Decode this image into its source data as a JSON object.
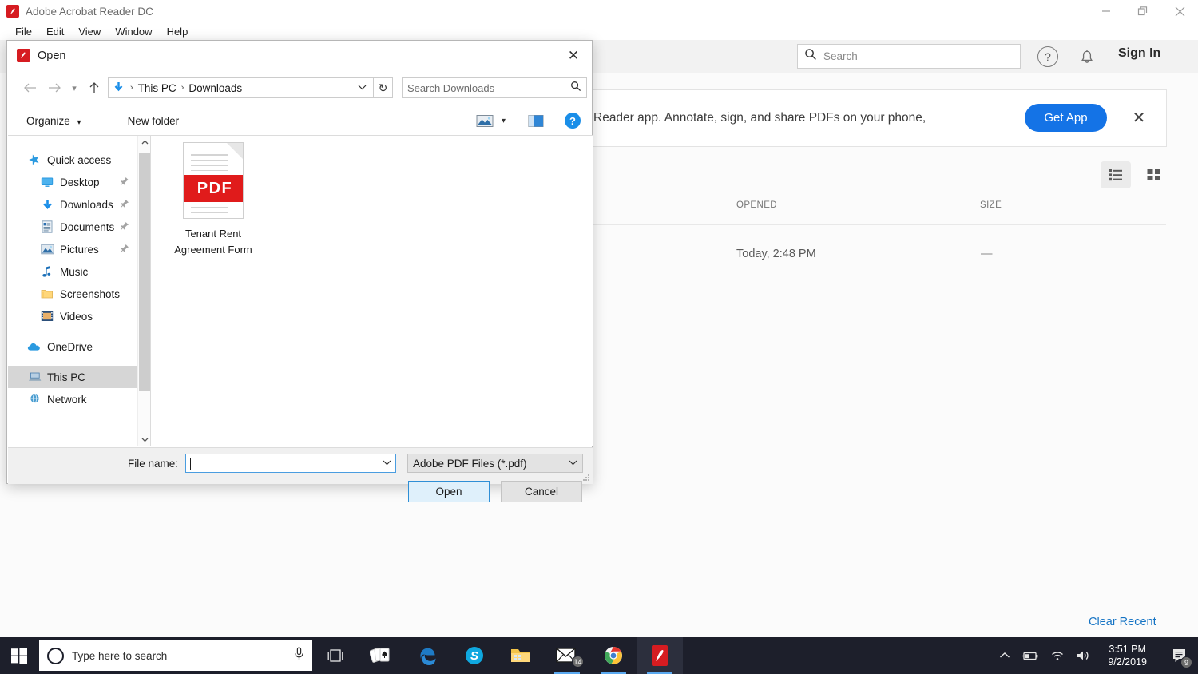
{
  "acrobat": {
    "title": "Adobe Acrobat Reader DC",
    "logo_letter": "A",
    "menu": [
      "File",
      "Edit",
      "View",
      "Window",
      "Help"
    ],
    "window_controls": {
      "minimize": "minimize-icon",
      "restore": "restore-icon",
      "close": "close-icon"
    },
    "search": {
      "placeholder": "Search",
      "icon": "search-icon"
    },
    "help_icon": "?",
    "bell_icon": "notification-bell-icon",
    "sign_in": "Sign In"
  },
  "promo": {
    "text": "Reader app. Annotate, sign, and share PDFs on your phone,",
    "button": "Get App",
    "close": "✕",
    "accent": "#1473e6"
  },
  "recent_list": {
    "view_toggle": {
      "list": "list-view-icon",
      "grid": "grid-view-icon",
      "active": "list"
    },
    "columns": [
      "OPENED",
      "SIZE"
    ],
    "rows": [
      {
        "opened": "Today, 2:48 PM",
        "size": "—"
      }
    ],
    "clear_recent": "Clear Recent",
    "link_color": "#1473c4"
  },
  "dialog": {
    "title": "Open",
    "logo_letter": "A",
    "close": "✕",
    "nav": {
      "back": "back-arrow-icon",
      "forward": "forward-arrow-icon",
      "recent": "recent-locations-icon",
      "up": "up-arrow-icon"
    },
    "address": {
      "location_icon": "downloads-arrow-icon",
      "crumbs": [
        "This PC",
        "Downloads"
      ],
      "separator": "›",
      "dropdown": "⌄",
      "refresh": "↻"
    },
    "search": {
      "placeholder": "Search Downloads",
      "icon": "search-icon"
    },
    "toolbar": {
      "organize": "Organize",
      "organize_caret": "▾",
      "new_folder": "New folder",
      "view_icon": "change-view-icon",
      "view_caret": "▾",
      "preview_pane_icon": "preview-pane-icon",
      "help_icon": "?"
    },
    "navpane": {
      "items": [
        {
          "label": "Quick access",
          "icon": "star-icon",
          "level": 0,
          "pinned": false,
          "selected": false
        },
        {
          "label": "Desktop",
          "icon": "desktop-icon",
          "level": 1,
          "pinned": true,
          "selected": false
        },
        {
          "label": "Downloads",
          "icon": "downloads-icon",
          "level": 1,
          "pinned": true,
          "selected": false
        },
        {
          "label": "Documents",
          "icon": "documents-icon",
          "level": 1,
          "pinned": true,
          "selected": false
        },
        {
          "label": "Pictures",
          "icon": "pictures-icon",
          "level": 1,
          "pinned": true,
          "selected": false
        },
        {
          "label": "Music",
          "icon": "music-icon",
          "level": 1,
          "pinned": false,
          "selected": false
        },
        {
          "label": "Screenshots",
          "icon": "folder-icon",
          "level": 1,
          "pinned": false,
          "selected": false
        },
        {
          "label": "Videos",
          "icon": "videos-icon",
          "level": 1,
          "pinned": false,
          "selected": false
        },
        {
          "label": "OneDrive",
          "icon": "onedrive-cloud-icon",
          "level": 0,
          "pinned": false,
          "selected": false
        },
        {
          "label": "This PC",
          "icon": "this-pc-icon",
          "level": 0,
          "pinned": false,
          "selected": true
        },
        {
          "label": "Network",
          "icon": "network-icon",
          "level": 0,
          "pinned": false,
          "selected": false
        }
      ],
      "scroll_up": "˄",
      "scroll_down": "˅"
    },
    "files": [
      {
        "name_line1": "Tenant Rent",
        "name_line2": "Agreement Form",
        "type_badge": "PDF",
        "icon": "pdf-file-icon"
      }
    ],
    "footer": {
      "file_name_label": "File name:",
      "file_name_value": "",
      "file_type_value": "Adobe PDF Files (*.pdf)",
      "open_button": "Open",
      "cancel_button": "Cancel",
      "dropdown_caret": "⌄"
    }
  },
  "taskbar": {
    "start_icon": "windows-start-icon",
    "search_placeholder": "Type here to search",
    "cortana_icon": "cortana-ring-icon",
    "mic_icon": "microphone-icon",
    "apps": [
      {
        "name": "task-view-icon",
        "active": false,
        "running": false
      },
      {
        "name": "solitaire-icon",
        "active": false,
        "running": true
      },
      {
        "name": "edge-icon",
        "active": false,
        "running": true
      },
      {
        "name": "skype-icon",
        "active": false,
        "running": false
      },
      {
        "name": "file-explorer-icon",
        "active": false,
        "running": false
      },
      {
        "name": "mail-icon",
        "active": false,
        "running": true,
        "badge": "14"
      },
      {
        "name": "chrome-icon",
        "active": false,
        "running": true
      },
      {
        "name": "acrobat-icon",
        "active": true,
        "running": true
      }
    ],
    "tray": {
      "chevron": "⌃",
      "battery": "battery-icon",
      "wifi": "wifi-icon",
      "volume": "volume-icon"
    },
    "clock_time": "3:51 PM",
    "clock_date": "9/2/2019",
    "action_center_badge": "9",
    "action_center_icon": "action-center-icon"
  }
}
